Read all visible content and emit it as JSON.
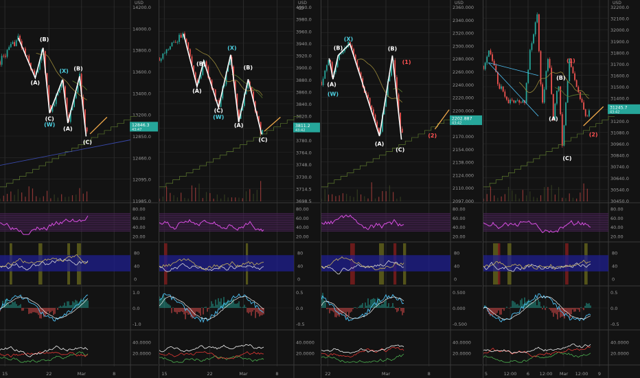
{
  "theme": {
    "bg": "#131313",
    "grid": "#2a2a2a",
    "axis_text": "#9a9a9a",
    "sep": "#3a3a3a",
    "up": "#26a69a",
    "down": "#ef5350",
    "wave": "#ffffff",
    "proj": "#f0a94a",
    "rsi": "#d94fe3",
    "rsi_band": "#3a1e44",
    "osc_band": "#1f1f8f",
    "osc_a": "#d9d9d9",
    "osc_b": "#c8b25a",
    "highlight": "#6b6b1e",
    "red_bar": "#8a1f1f",
    "macd": "#4fc3f7",
    "signal": "#f5f5f5",
    "dmi_plus": "#4caf50",
    "dmi_minus": "#e53935",
    "adx": "#f5f5f5",
    "cyan_label": "#4dd0e1",
    "red_label": "#ff5252",
    "ma_green": "#5d7a2e",
    "ma_olive": "#9a8a3a",
    "ma_dark": "#4a5a2a",
    "ma_blue": "#3949ab"
  },
  "chart_data": [
    {
      "type": "candlestick",
      "currency": "USD",
      "x_ticks": [
        "15",
        "22",
        "Mar",
        "8"
      ],
      "price_ticks": [
        "14200.0",
        "14000.0",
        "13800.0",
        "13600.0",
        "13400.0",
        "13200.0",
        "12850.0",
        "12460.0",
        "12095.0",
        "11985.0"
      ],
      "price_range": [
        11985,
        14330
      ],
      "last_price": "12846.3",
      "last_price_sub": "43:47",
      "last_value": 12846.3,
      "labels": [
        {
          "text": "(A)",
          "color": "white",
          "t": 0.27,
          "v": 13350
        },
        {
          "text": "(B)",
          "color": "white",
          "t": 0.34,
          "v": 13870
        },
        {
          "text": "(C)",
          "color": "white",
          "t": 0.38,
          "v": 12920
        },
        {
          "text": "(W)",
          "color": "cyan",
          "t": 0.38,
          "v": 12850
        },
        {
          "text": "(X)",
          "color": "cyan",
          "t": 0.49,
          "v": 13490
        },
        {
          "text": "(A)",
          "color": "white",
          "t": 0.52,
          "v": 12800
        },
        {
          "text": "(B)",
          "color": "white",
          "t": 0.6,
          "v": 13520
        },
        {
          "text": "(C)",
          "color": "white",
          "t": 0.67,
          "v": 12640
        }
      ],
      "wave": [
        [
          0.14,
          13910
        ],
        [
          0.27,
          13430
        ],
        [
          0.33,
          13790
        ],
        [
          0.38,
          13010
        ],
        [
          0.48,
          13410
        ],
        [
          0.52,
          12890
        ],
        [
          0.61,
          13450
        ],
        [
          0.66,
          12730
        ]
      ],
      "projection": [
        [
          0.69,
          12760
        ],
        [
          0.82,
          12960
        ]
      ],
      "rsi_ticks": [
        "80.00",
        "60.00",
        "40.00",
        "20.00"
      ],
      "osc_ticks": [
        "80",
        "40",
        "0"
      ],
      "macd_ticks": [
        "1.0",
        "0.0",
        "-1.0"
      ],
      "dmi_ticks": [
        "40.0000",
        "20.0000"
      ]
    },
    {
      "type": "candlestick",
      "currency": "USD",
      "currency_sub": "Ꝏ",
      "x_ticks": [
        "15",
        "22",
        "Mar",
        "8"
      ],
      "price_ticks": [
        "4000.0",
        "3980.0",
        "3960.0",
        "3940.0",
        "3920.0",
        "3900.0",
        "3880.0",
        "3860.0",
        "3840.0",
        "3820.0",
        "3800.0",
        "3780.0",
        "3764.0",
        "3748.0",
        "3730.0",
        "3714.5",
        "3698.5"
      ],
      "price_range": [
        3695,
        4015
      ],
      "last_price": "3811.2",
      "last_price_sub": "43:42",
      "last_value": 3811.2,
      "labels": [
        {
          "text": "(A)",
          "color": "white",
          "t": 0.28,
          "v": 3868
        },
        {
          "text": "(B)",
          "color": "white",
          "t": 0.31,
          "v": 3912
        },
        {
          "text": "(C)",
          "color": "white",
          "t": 0.44,
          "v": 3836
        },
        {
          "text": "(W)",
          "color": "cyan",
          "t": 0.44,
          "v": 3825
        },
        {
          "text": "(X)",
          "color": "cyan",
          "t": 0.54,
          "v": 3938
        },
        {
          "text": "(A)",
          "color": "white",
          "t": 0.59,
          "v": 3812
        },
        {
          "text": "(B)",
          "color": "white",
          "t": 0.66,
          "v": 3906
        },
        {
          "text": "(C)",
          "color": "white",
          "t": 0.77,
          "v": 3788
        }
      ],
      "wave": [
        [
          0.18,
          3964
        ],
        [
          0.28,
          3878
        ],
        [
          0.33,
          3920
        ],
        [
          0.44,
          3844
        ],
        [
          0.53,
          3930
        ],
        [
          0.59,
          3820
        ],
        [
          0.66,
          3890
        ],
        [
          0.76,
          3800
        ]
      ],
      "projection": [
        [
          0.78,
          3805
        ],
        [
          0.9,
          3828
        ]
      ],
      "rsi_ticks": [
        "80.00",
        "60.00",
        "40.00",
        "20.00"
      ],
      "osc_ticks": [
        "80",
        "40",
        "0"
      ],
      "macd_ticks": [
        "0.5",
        "0.0",
        "-0.5"
      ],
      "dmi_ticks": [
        "40.0000",
        "20.0000"
      ]
    },
    {
      "type": "candlestick",
      "currency": "USD",
      "x_ticks": [
        "22",
        "Mar",
        "8"
      ],
      "price_ticks": [
        "2360.000",
        "2340.000",
        "2320.000",
        "2300.000",
        "2280.000",
        "2260.000",
        "2240.000",
        "2220.000",
        "2200.000",
        "2185.000",
        "2170.000",
        "2154.000",
        "2138.000",
        "2124.000",
        "2110.000",
        "2097.000"
      ],
      "price_range": [
        2090,
        2372
      ],
      "last_price": "2202.887",
      "last_price_sub": "43:42",
      "last_value": 2202.887,
      "labels": [
        {
          "text": "(A)",
          "color": "white",
          "t": 0.08,
          "v": 2252
        },
        {
          "text": "(W)",
          "color": "cyan",
          "t": 0.09,
          "v": 2238
        },
        {
          "text": "(B)",
          "color": "white",
          "t": 0.13,
          "v": 2304
        },
        {
          "text": "(X)",
          "color": "cyan",
          "t": 0.21,
          "v": 2317
        },
        {
          "text": "(A)",
          "color": "white",
          "t": 0.45,
          "v": 2166
        },
        {
          "text": "(B)",
          "color": "white",
          "t": 0.55,
          "v": 2303
        },
        {
          "text": "(1)",
          "color": "red",
          "t": 0.66,
          "v": 2284
        },
        {
          "text": "(C)",
          "color": "white",
          "t": 0.61,
          "v": 2158
        },
        {
          "text": "(2)",
          "color": "red",
          "t": 0.86,
          "v": 2178
        }
      ],
      "wave": [
        [
          0.06,
          2292
        ],
        [
          0.09,
          2262
        ],
        [
          0.13,
          2296
        ],
        [
          0.22,
          2313
        ],
        [
          0.45,
          2180
        ],
        [
          0.55,
          2296
        ],
        [
          0.62,
          2175
        ]
      ],
      "projection": [
        [
          0.88,
          2190
        ],
        [
          0.99,
          2218
        ]
      ],
      "rsi_ticks": [
        "80.00",
        "60.00",
        "40.00",
        "20.00"
      ],
      "osc_ticks": [
        "80",
        "40",
        "0"
      ],
      "macd_ticks": [
        "0.500",
        "0.000",
        "-0.500"
      ],
      "dmi_ticks": [
        "40.0000",
        "20.0000"
      ]
    },
    {
      "type": "candlestick",
      "currency": "USD",
      "x_ticks": [
        "5",
        "12:00",
        "6",
        "12:00",
        "Mar",
        "12:00",
        "9"
      ],
      "price_ticks": [
        "32200.0",
        "32100.0",
        "32000.0",
        "31900.0",
        "31800.0",
        "31700.0",
        "31600.0",
        "31500.0",
        "31400.0",
        "31300.0",
        "31200.0",
        "31080.0",
        "30960.0",
        "30840.0",
        "30740.0",
        "30640.0",
        "30540.0",
        "30450.0"
      ],
      "price_range": [
        30410,
        32240
      ],
      "last_price": "31245.7",
      "last_price_sub": "43:42",
      "last_value": 31245.7,
      "labels": [
        {
          "text": "(A)",
          "color": "white",
          "t": 0.56,
          "v": 31140
        },
        {
          "text": "(B)",
          "color": "white",
          "t": 0.62,
          "v": 31520
        },
        {
          "text": "(1)",
          "color": "red",
          "t": 0.7,
          "v": 31680
        },
        {
          "text": "(C)",
          "color": "white",
          "t": 0.67,
          "v": 30770
        },
        {
          "text": "(2)",
          "color": "red",
          "t": 0.88,
          "v": 30990
        }
      ],
      "wave": [],
      "projection": [
        [
          0.8,
          31090
        ],
        [
          0.96,
          31270
        ]
      ],
      "rsi_ticks": [
        "80.00",
        "60.00",
        "40.00",
        "20.00"
      ],
      "osc_ticks": [
        "80",
        "40",
        "0"
      ],
      "macd_ticks": [
        "0.5",
        "0.0",
        "-0.5"
      ],
      "dmi_ticks": [
        "40.0000",
        "20.0000"
      ]
    }
  ]
}
